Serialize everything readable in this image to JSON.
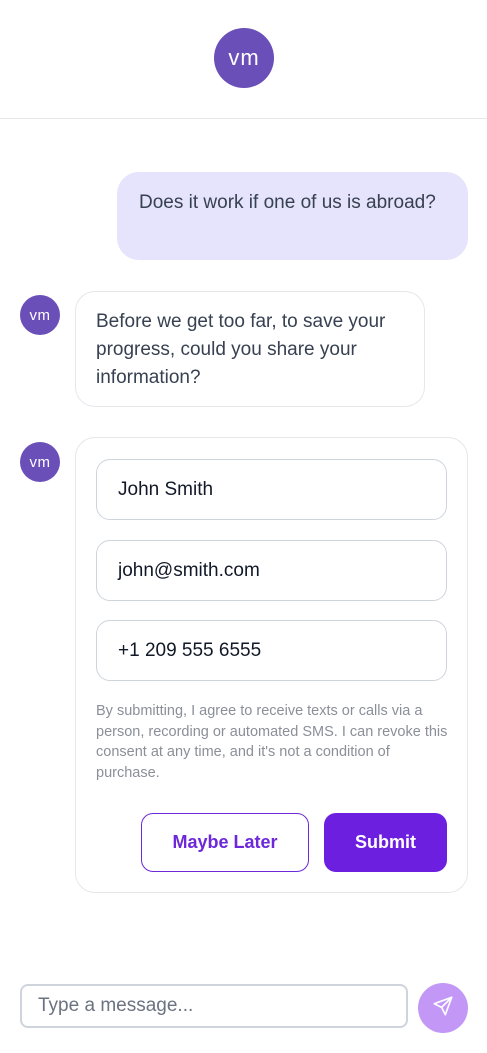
{
  "header": {
    "logo_text": "vm"
  },
  "messages": {
    "user_1": "Does it work if one of us is abroad?",
    "bot_1": "Before we get too far, to save your progress, could you share your information?",
    "avatar_text": "vm"
  },
  "form": {
    "name_value": "John Smith",
    "email_value": "john@smith.com",
    "phone_value": "+1 209 555 6555",
    "consent_text": "By submitting, I agree to receive texts or calls via a person, recording or automated SMS. I can revoke this consent at any time, and it's not a condition of purchase.",
    "maybe_later_label": "Maybe Later",
    "submit_label": "Submit"
  },
  "composer": {
    "placeholder": "Type a message...",
    "send_icon": "send-icon"
  },
  "colors": {
    "brand": "#6b4fb8",
    "accent": "#6d1fe0",
    "user_bubble": "#e6e3fc",
    "send_button": "#c297f5"
  }
}
